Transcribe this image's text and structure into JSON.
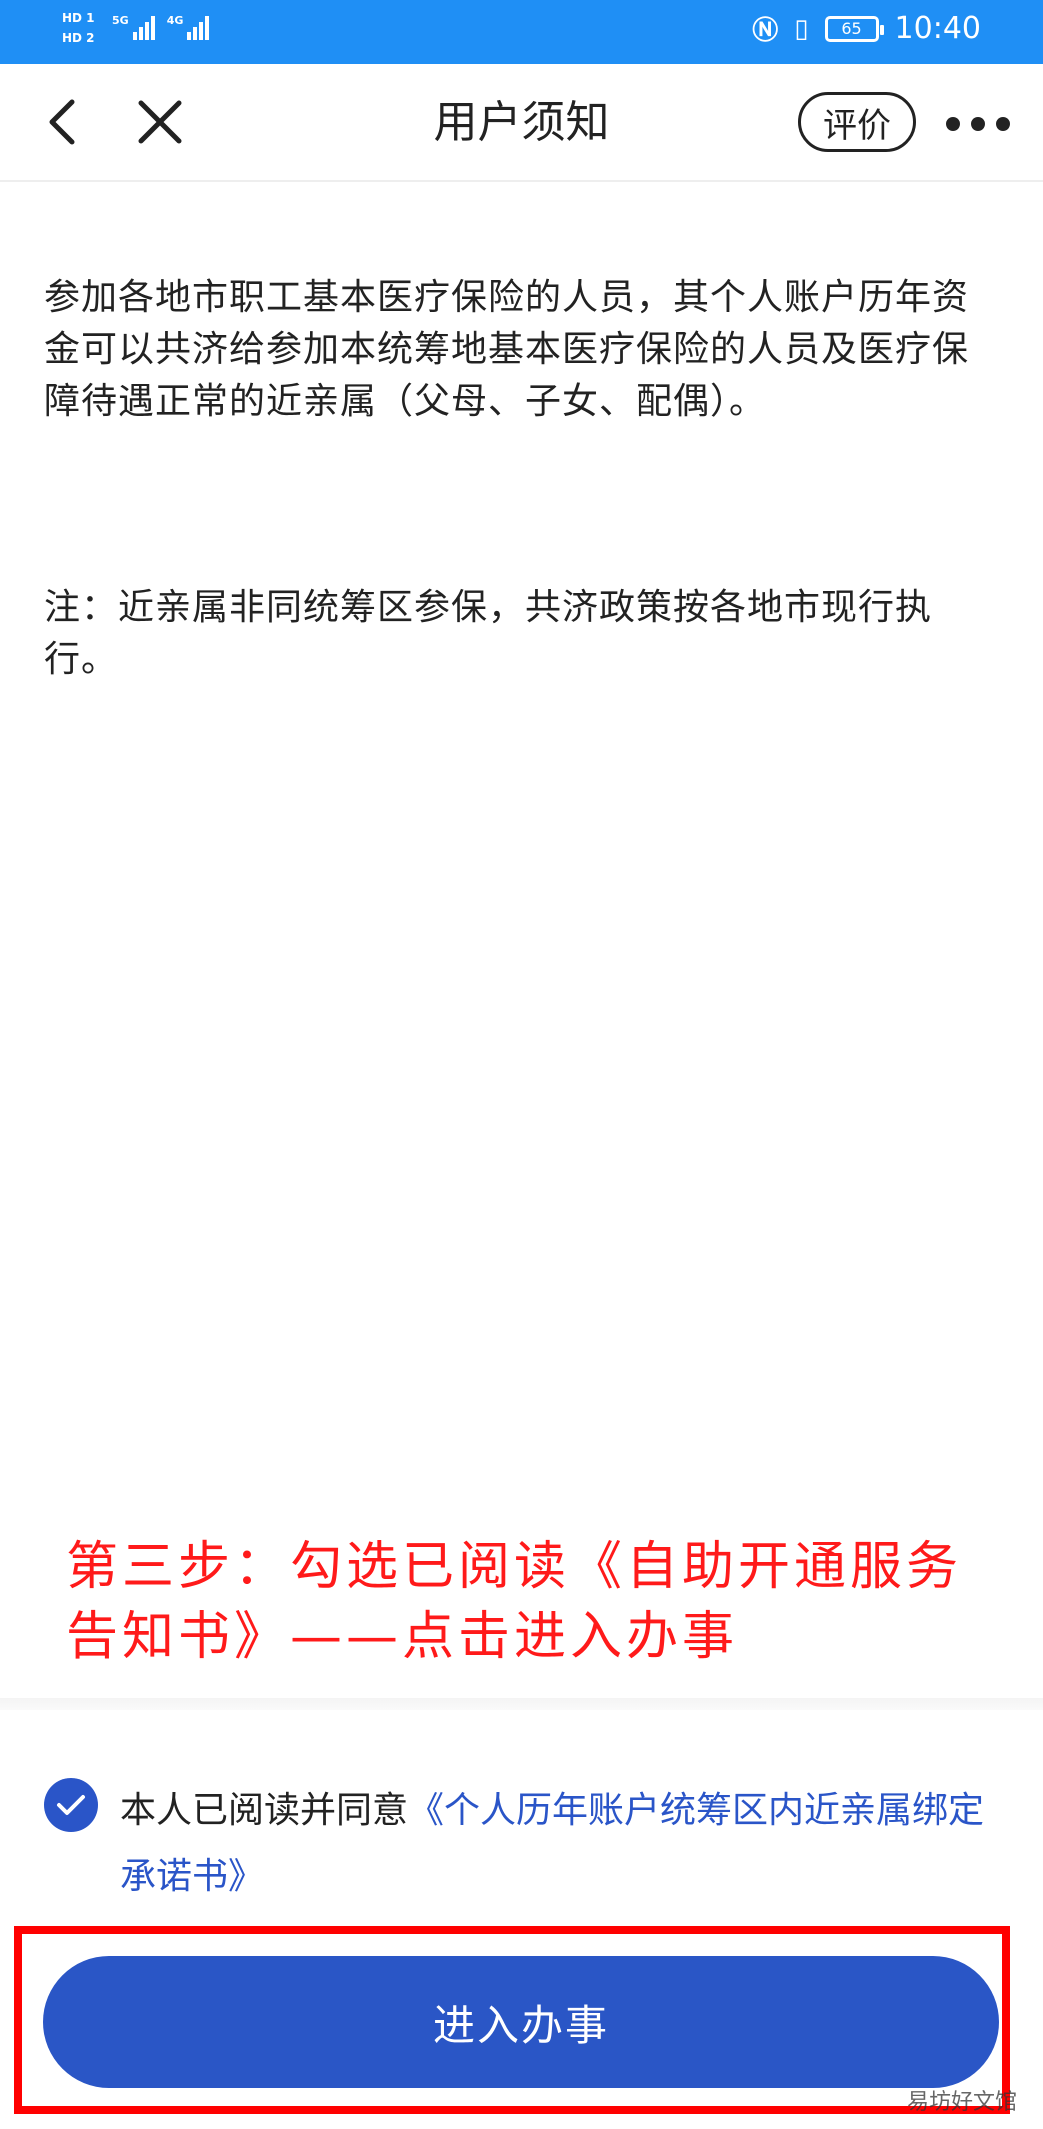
{
  "status_bar": {
    "hd1": "HD 1",
    "hd2": "HD 2",
    "net1": "5G",
    "net2": "4G",
    "battery": "65",
    "time": "10:40"
  },
  "nav": {
    "title": "用户须知",
    "rate_label": "评价"
  },
  "content": {
    "paragraph1": "参加各地市职工基本医疗保险的人员，其个人账户历年资金可以共济给参加本统筹地基本医疗保险的人员及医疗保障待遇正常的近亲属（父母、子女、配偶）。",
    "paragraph2": "注：近亲属非同统筹区参保，共济政策按各地市现行执行。"
  },
  "annotation": "第三步：勾选已阅读《自助开通服务告知书》——点击进入办事",
  "agreement": {
    "checked": true,
    "prefix": "本人已阅读并同意",
    "link": "《个人历年账户统筹区内近亲属绑定承诺书》"
  },
  "primary_button": "进入办事",
  "watermark": "易坊好文馆",
  "colors": {
    "status_bar": "#1f8ff5",
    "primary": "#2a56c6",
    "annotation": "#ff1a1a",
    "highlight": "#ff0000"
  }
}
